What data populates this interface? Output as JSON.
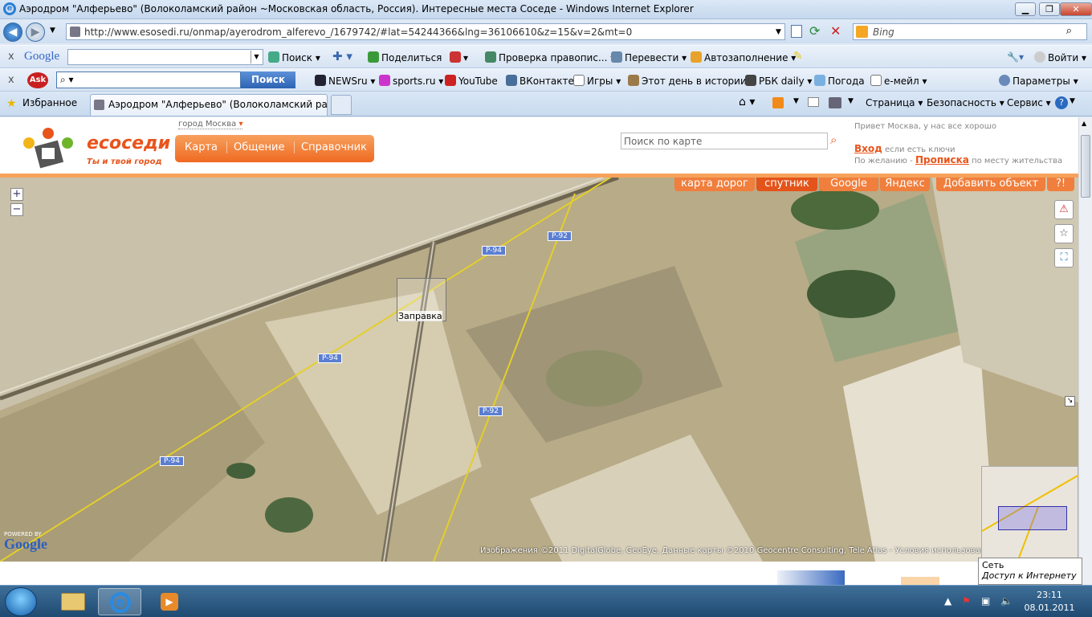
{
  "window": {
    "title": "Аэродром \"Алферьево\" (Волоколамский район ~Московская область, Россия). Интересные места Соседе - Windows Internet Explorer",
    "minimize": "▁",
    "maximize": "❐",
    "close": "✕"
  },
  "nav": {
    "back": "◀",
    "forward": "▶",
    "url": "http://www.esosedi.ru/onmap/ayerodrom_alferevo_/1679742/#lat=54244366&lng=36106610&z=15&v=2&mt=0",
    "search_placeholder": "Bing"
  },
  "google_bar": {
    "close": "x",
    "logo": "Google",
    "search_value": "",
    "items": [
      "Поиск",
      "Поделиться",
      "Проверка правопис...",
      "Перевести",
      "Автозаполнение"
    ],
    "signin": "Войти"
  },
  "ask_bar": {
    "close": "x",
    "logo": "Ask",
    "search_value": "",
    "search_button": "Поиск",
    "links": [
      "NEWSru",
      "sports.ru",
      "YouTube",
      "ВКонтакте",
      "Игры",
      "Этот день в истории",
      "РБК daily",
      "Погода",
      "е-мейл"
    ],
    "settings": "Параметры"
  },
  "tabs": {
    "favorites": "Избранное",
    "active_tab": "Аэродром \"Алферьево\" (Волоколамский райо...",
    "cmd": [
      "Страница",
      "Безопасность",
      "Сервис"
    ]
  },
  "site": {
    "brand": "eсоседи",
    "slogan": "Ты и твой город",
    "city": "город Москва",
    "nav": [
      "Карта",
      "Общение",
      "Справочник"
    ],
    "map_search_placeholder": "Поиск по карте",
    "greeting": "Привет Москва, у нас все хорошо",
    "login": "Вход",
    "login_suffix": "если есть ключи",
    "register_prefix": "По желанию -",
    "register": "Прописка",
    "register_suffix": "по месту жительства"
  },
  "map": {
    "tabs": [
      "карта дорог",
      "спутник",
      "Google",
      "Яндекс",
      "Добавить объект",
      "?!"
    ],
    "zoom_in": "+",
    "zoom_out": "−",
    "poi_label": "Заправка",
    "roads": [
      "P-94",
      "P-92",
      "P-94",
      "P-92",
      "P-94"
    ],
    "copyright": "Изображения ©2011 DigitalGlobe, GeoEye, Данные карты ©2010 Geocentre Consulting, Tele Atlas - Условия использования",
    "powered": "POWERED BY",
    "google_logo": "Google"
  },
  "tooltip": {
    "title": "Сеть",
    "text": "Доступ к Интернету"
  },
  "taskbar": {
    "time": "23:11",
    "date": "08.01.2011"
  }
}
